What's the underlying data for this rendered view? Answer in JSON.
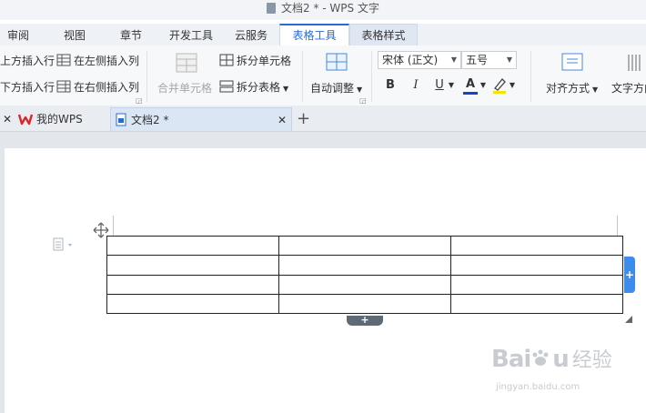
{
  "window": {
    "title": "文档2 * - WPS 文字"
  },
  "ribbon_tabs": [
    {
      "label": "审阅"
    },
    {
      "label": "视图"
    },
    {
      "label": "章节"
    },
    {
      "label": "开发工具"
    },
    {
      "label": "云服务"
    },
    {
      "label": "表格工具"
    },
    {
      "label": "表格样式"
    }
  ],
  "ribbon": {
    "insert_above": "上方插入行",
    "insert_below": "下方插入行",
    "insert_left": "在左侧插入列",
    "insert_right": "在右侧插入列",
    "merge_cells": "合并单元格",
    "split_cells": "拆分单元格",
    "split_table": "拆分表格",
    "auto_fit": "自动调整",
    "font_name": "宋体 (正文)",
    "font_size": "五号",
    "bold": "B",
    "italic": "I",
    "underline": "U",
    "font_color": "A",
    "align": "对齐方式",
    "text_dir": "文字方向",
    "font_color_hex": "#1a3fd1",
    "highlight_hex": "#f5e400"
  },
  "doc_tabs": [
    {
      "label": "我的WPS"
    },
    {
      "label": "文档2 *"
    }
  ],
  "watermark": {
    "logo": "Bai",
    "brand": "经验",
    "url": "jingyan.baidu.com"
  }
}
